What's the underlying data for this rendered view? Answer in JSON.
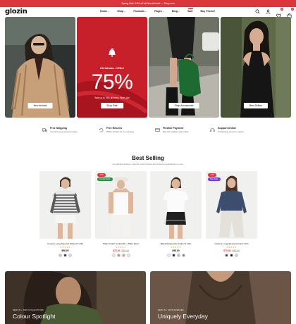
{
  "announcement": "Spring Sale: 15% off all New Arrivals — Shop now",
  "brand": {
    "logo": "glozin",
    "accent": "#d9373b"
  },
  "nav": [
    {
      "label": "Home",
      "arrow": true,
      "badge": ""
    },
    {
      "label": "Shop",
      "arrow": true,
      "badge": ""
    },
    {
      "label": "Products",
      "arrow": true,
      "badge": ""
    },
    {
      "label": "Pages",
      "arrow": true,
      "badge": ""
    },
    {
      "label": "Blog",
      "arrow": true,
      "badge": ""
    },
    {
      "label": "Sale",
      "arrow": false,
      "badge": "HOT"
    },
    {
      "label": "Buy Theme!",
      "arrow": false,
      "badge": ""
    }
  ],
  "header_icons": {
    "wishlist_count": "0",
    "cart_count": "0"
  },
  "hero": {
    "panel1": {
      "button": "New Arrivals"
    },
    "panel2": {
      "eyebrow": "Christmas • Offer!",
      "big": "75%",
      "sub": "Sale up to 75% all items. Hurry Up!",
      "button": "Shop Sale"
    },
    "panel3": {
      "button": "Shop Accessories"
    },
    "panel4": {
      "button": "Best Sellers"
    }
  },
  "features": [
    {
      "title": "Free Shipping",
      "sub": "You will love at great low prices",
      "icon": "truck-icon"
    },
    {
      "title": "Free Returns",
      "sub": "Within 15 days for an exchange",
      "icon": "returns-icon"
    },
    {
      "title": "Flexible Payment",
      "sub": "Pay with multiple credit cards",
      "icon": "card-icon"
    },
    {
      "title": "Support Online",
      "sub": "Outstanding premium support",
      "icon": "headset-icon"
    }
  ],
  "best_selling": {
    "title": "Best Selling",
    "subtitle": "Unmatched design—superior performance and customer satisfaction in one."
  },
  "products": [
    {
      "name": "Contour Long-Sleeved Striped T-shirt",
      "price": "$98.00",
      "old_price": "",
      "badge": "",
      "badge2": "",
      "sale": false,
      "rating": "★★★★★",
      "swatches": [
        "#c6c6c6",
        "#3a3a3a",
        "#e3d6c7"
      ]
    },
    {
      "name": "Plain Cotton Undershirt - White Neck",
      "price": "$75.00",
      "old_price": "$88.00",
      "badge": "-15%",
      "badge2": "Limited Stock",
      "sale": true,
      "rating": "★★★★★",
      "swatches": [
        "#f0e7dc",
        "#c59070",
        "#e8a07a",
        "#e6e6e6"
      ]
    },
    {
      "name": "Black Relaxed Fit Cotton T-shirt",
      "price": "$98.00",
      "old_price": "",
      "badge": "",
      "badge2": "",
      "sale": false,
      "rating": "★★★★★",
      "swatches": [
        "#ececec",
        "#2b2b2b",
        "#bfbfbf",
        "#9a8f84"
      ]
    },
    {
      "name": "Contour Long-Sleeved Crop T-shirt",
      "price": "$75.00",
      "old_price": "$88.00",
      "badge": "-15%",
      "badge2": "Pre-Order",
      "sale": true,
      "rating": "★★★★★",
      "swatches": [
        "#3c4b6b",
        "#2b2b2b",
        "#d6cfc7"
      ]
    }
  ],
  "promos": [
    {
      "eyebrow": "NEW IN • 2025 COLLECTIONS",
      "title": "Colour Spotlight"
    },
    {
      "eyebrow": "NEW IN • 2025 DRESSES",
      "title": "Uniquely Everyday"
    }
  ]
}
